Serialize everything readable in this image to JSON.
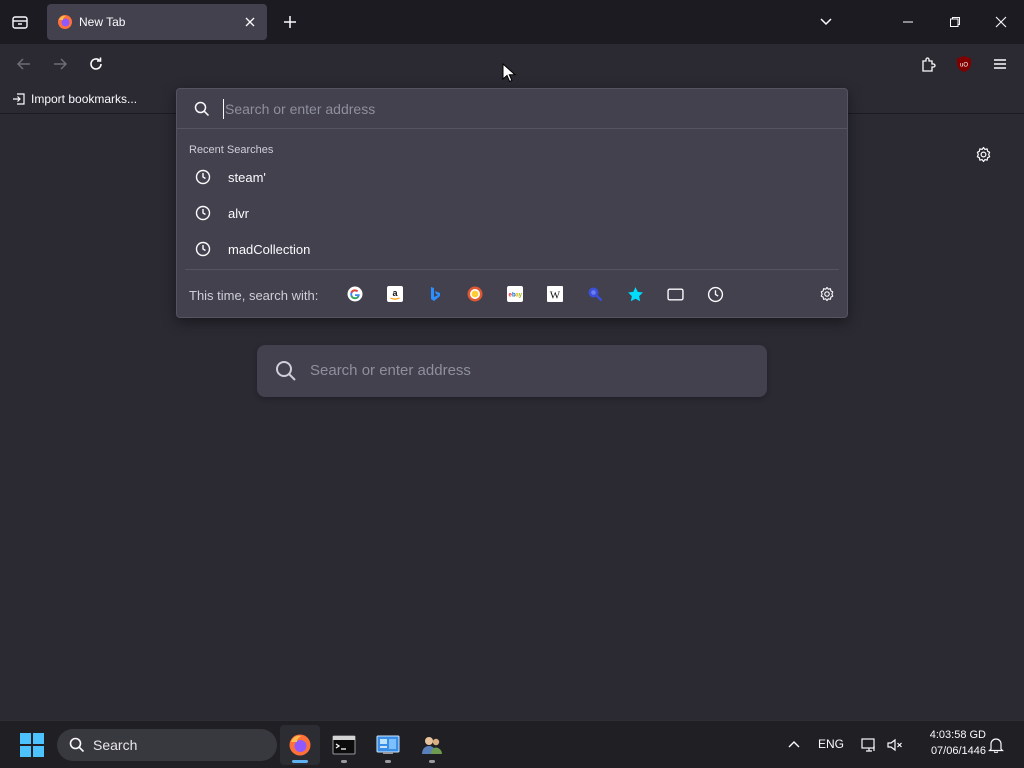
{
  "browser": {
    "tab": {
      "title": "New Tab"
    },
    "bookmarks": {
      "import_label": "Import bookmarks..."
    }
  },
  "urlbar": {
    "placeholder": "Search or enter address",
    "recent_heading": "Recent Searches",
    "recent_searches": [
      "steam'",
      "alvr",
      "madCollection"
    ],
    "oneoff_label": "This time, search with:",
    "engines": [
      "google-icon",
      "amazon-icon",
      "bing-icon",
      "duckduckgo-icon",
      "ebay-icon",
      "wikipedia-icon",
      "search-engine-icon",
      "bookmarks-icon",
      "tabs-icon",
      "history-icon"
    ]
  },
  "newtab": {
    "search_placeholder": "Search or enter address"
  },
  "taskbar": {
    "search_label": "Search",
    "language": "ENG",
    "time": "4:03:58 GD",
    "date": "07/06/1446"
  },
  "colors": {
    "accent": "#5fb2f2",
    "ublock_red": "#c0392b",
    "panel_bg": "#42414d",
    "page_bg": "#2b2a33"
  }
}
